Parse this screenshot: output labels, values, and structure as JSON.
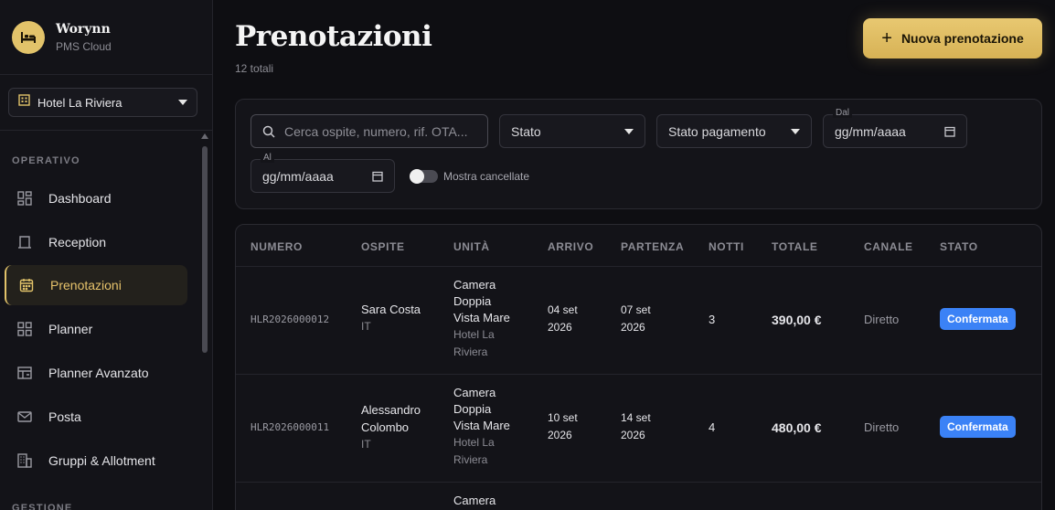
{
  "brand": {
    "name": "Worynn",
    "subtitle": "PMS Cloud"
  },
  "hotel_selector": {
    "value": "Hotel La Riviera"
  },
  "sidebar": {
    "sections": [
      {
        "label": "OPERATIVO"
      },
      {
        "label": "GESTIONE"
      }
    ],
    "items": [
      {
        "label": "Dashboard",
        "icon": "dashboard-icon"
      },
      {
        "label": "Reception",
        "icon": "reception-icon"
      },
      {
        "label": "Prenotazioni",
        "icon": "calendar-icon",
        "active": true
      },
      {
        "label": "Planner",
        "icon": "grid-icon"
      },
      {
        "label": "Planner Avanzato",
        "icon": "layout-icon"
      },
      {
        "label": "Posta",
        "icon": "mail-icon"
      },
      {
        "label": "Gruppi & Allotment",
        "icon": "building-icon"
      }
    ]
  },
  "header": {
    "title": "Prenotazioni",
    "subtitle": "12 totali",
    "new_button": "Nuova prenotazione"
  },
  "filters": {
    "search_placeholder": "Cerca ospite, numero, rif. OTA...",
    "status": "Stato",
    "payment_status": "Stato pagamento",
    "from_label": "Dal",
    "from_value": "gg/mm/aaaa",
    "to_label": "Al",
    "to_value": "gg/mm/aaaa",
    "show_cancelled": "Mostra cancellate"
  },
  "table": {
    "columns": [
      "NUMERO",
      "OSPITE",
      "UNITÀ",
      "ARRIVO",
      "PARTENZA",
      "NOTTI",
      "TOTALE",
      "CANALE",
      "STATO"
    ],
    "rows": [
      {
        "number": "HLR2026000012",
        "guest": "Sara Costa",
        "country": "IT",
        "unit_line1": "Camera",
        "unit_line2": "Doppia",
        "unit_line3": "Vista Mare",
        "hotel_line1": "Hotel La",
        "hotel_line2": "Riviera",
        "arrival_line1": "04 set",
        "arrival_line2": "2026",
        "departure_line1": "07 set",
        "departure_line2": "2026",
        "nights": "3",
        "total": "390,00 €",
        "channel": "Diretto",
        "status": "Confermata"
      },
      {
        "number": "HLR2026000011",
        "guest_line1": "Alessandro",
        "guest_line2": "Colombo",
        "country": "IT",
        "unit_line1": "Camera",
        "unit_line2": "Doppia",
        "unit_line3": "Vista Mare",
        "hotel_line1": "Hotel La",
        "hotel_line2": "Riviera",
        "arrival_line1": "10 set",
        "arrival_line2": "2026",
        "departure_line1": "14 set",
        "departure_line2": "2026",
        "nights": "4",
        "total": "480,00 €",
        "channel": "Diretto",
        "status": "Confermata"
      },
      {
        "unit_line1": "Camera"
      }
    ]
  }
}
